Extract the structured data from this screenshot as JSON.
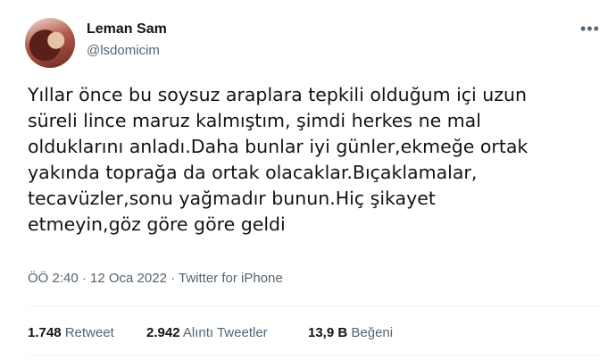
{
  "user": {
    "name": "Leman Sam",
    "handle": "@lsdomicim"
  },
  "tweet": {
    "lines": [
      "Yıllar önce bu soysuz araplara tepkili olduğum içi uzun",
      "süreli lince maruz kalmıştım, şimdi herkes ne mal",
      "olduklarını anladı.Daha bunlar iyi günler,ekmeğe ortak",
      "yakında toprağa da ortak olacaklar.Bıçaklamalar,",
      "tecavüzler,sonu yağmadır bunun.Hiç şikayet",
      "etmeyin,göz göre göre geldi"
    ],
    "meta": "ÖÖ 2:40 · 12 Oca 2022 · Twitter for iPhone"
  },
  "stats": {
    "retweets": {
      "count": "1.748",
      "label": "Retweet"
    },
    "quotes": {
      "count": "2.942",
      "label": "Alıntı Tweetler"
    },
    "likes": {
      "count": "13,9 B",
      "label": "Beğeni"
    }
  },
  "icons": {
    "more": "more-dots-icon"
  }
}
